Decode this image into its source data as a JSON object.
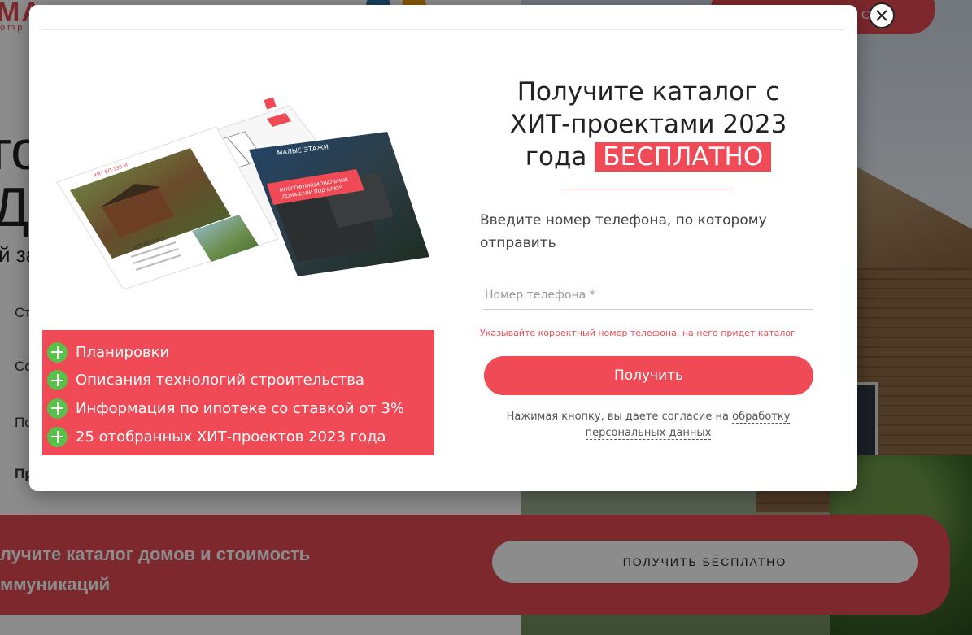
{
  "background": {
    "logo": "МА",
    "logo_sub": "omp",
    "header_button_label": "ОР",
    "heading_line1": "го",
    "heading_line2": "Д",
    "subheading": "й за",
    "list_items": [
      "Ст",
      "Со",
      "По",
      "Пр"
    ],
    "banner_text": "лучите каталог домов и стоимость ммуникаций",
    "banner_button_label": "ПОЛУЧИТЬ БЕСПЛАТНО"
  },
  "modal": {
    "close_label": "×",
    "catalog": {
      "brand": "МАЛЫЕ ЭТАЖИ",
      "cover_title_line1": "МНОГОФУНКЦИОНАЛЬНЫЕ",
      "cover_title_line2": "ДОМА-БАНИ ПОД КЛЮЧ",
      "page_title_1": "ХИТ БП-150 М",
      "page_title_2": "ДОМ-БАНЯ № 4"
    },
    "features": [
      "Планировки",
      "Описания технологий строительства",
      "Информация по ипотеке со ставкой от 3%",
      "25 отобранных ХИТ-проектов 2023 года"
    ],
    "form": {
      "title_line1": "Получите каталог с",
      "title_line2": "ХИТ-проектами 2023",
      "title_line3": "года",
      "title_highlight": "БЕСПЛАТНО",
      "description": "Введите номер телефона, по которому отправить",
      "phone_placeholder": "Номер телефона *",
      "phone_value": "",
      "hint": "Указывайте корректный номер телефона, на него придет каталог",
      "submit_label": "Получить",
      "consent_text": "Нажимая кнопку, вы даете согласие на",
      "consent_link": "обработку персональных данных"
    }
  },
  "colors": {
    "accent": "#ef4a56",
    "plus_icon": "#58c148"
  }
}
